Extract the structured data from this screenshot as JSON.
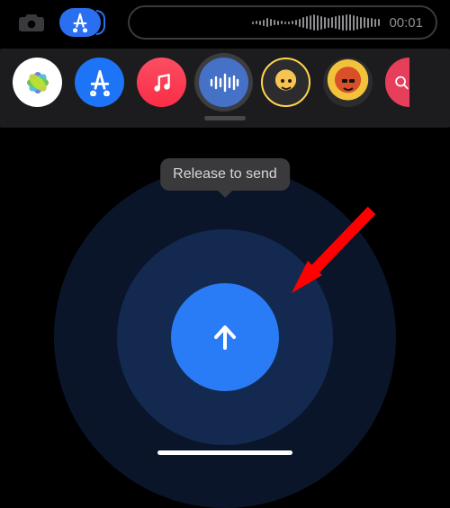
{
  "recorder": {
    "timer": "00:01",
    "waveform_bars": [
      3,
      4,
      5,
      7,
      10,
      8,
      6,
      5,
      4,
      3,
      3,
      4,
      6,
      9,
      12,
      14,
      16,
      18,
      17,
      15,
      13,
      11,
      12,
      14,
      16,
      17,
      18,
      18,
      17,
      15,
      13,
      12,
      11,
      10,
      9,
      8
    ]
  },
  "tooltip": "Release to send",
  "apps": {
    "photos": "photos-icon",
    "appstore": "appstore-icon",
    "music": "music-icon",
    "audio": "audio-wave-icon",
    "memoji1": "memoji-icon",
    "memoji2": "memoji-icon",
    "search": "search-icon"
  },
  "colors": {
    "accent": "#2a7bf6",
    "ring_mid": "#14294f",
    "ring_outer": "#0a152a"
  }
}
